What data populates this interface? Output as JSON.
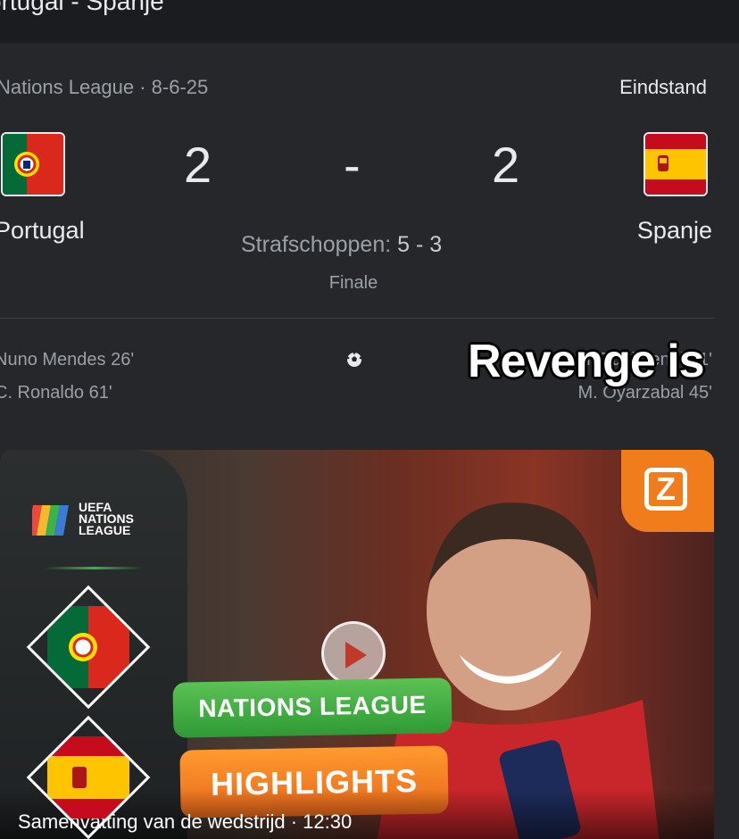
{
  "header": {
    "title": "ortugal - Spanje"
  },
  "match": {
    "meta": "Nations League · 8-6-25",
    "status": "Eindstand",
    "home": {
      "team": "Portugal",
      "score": "2",
      "flag": "portugal-flag"
    },
    "away": {
      "team": "Spanje",
      "score": "2",
      "flag": "spain-flag"
    },
    "separator": "-",
    "penalties_label": "Strafschoppen:",
    "penalties_score": "5 - 3",
    "round": "Finale",
    "home_scorers": [
      "Nuno Mendes 26'",
      "C. Ronaldo 61'"
    ],
    "away_scorers": [
      "M. Zubimendi 21'",
      "M. Oyarzabal 45'"
    ]
  },
  "overlay_caption": "Revenge is",
  "video": {
    "brand_lines": [
      "UEFA",
      "NATIONS",
      "LEAGUE"
    ],
    "badge": "Z",
    "tag_top": "NATIONS LEAGUE",
    "tag_bottom": "HIGHLIGHTS",
    "caption": "Samenvatting van de wedstrijd  ·  12:30"
  },
  "colors": {
    "background": "#202124",
    "card": "#26272b",
    "green": "#3bb34a",
    "orange": "#f07c1c"
  }
}
